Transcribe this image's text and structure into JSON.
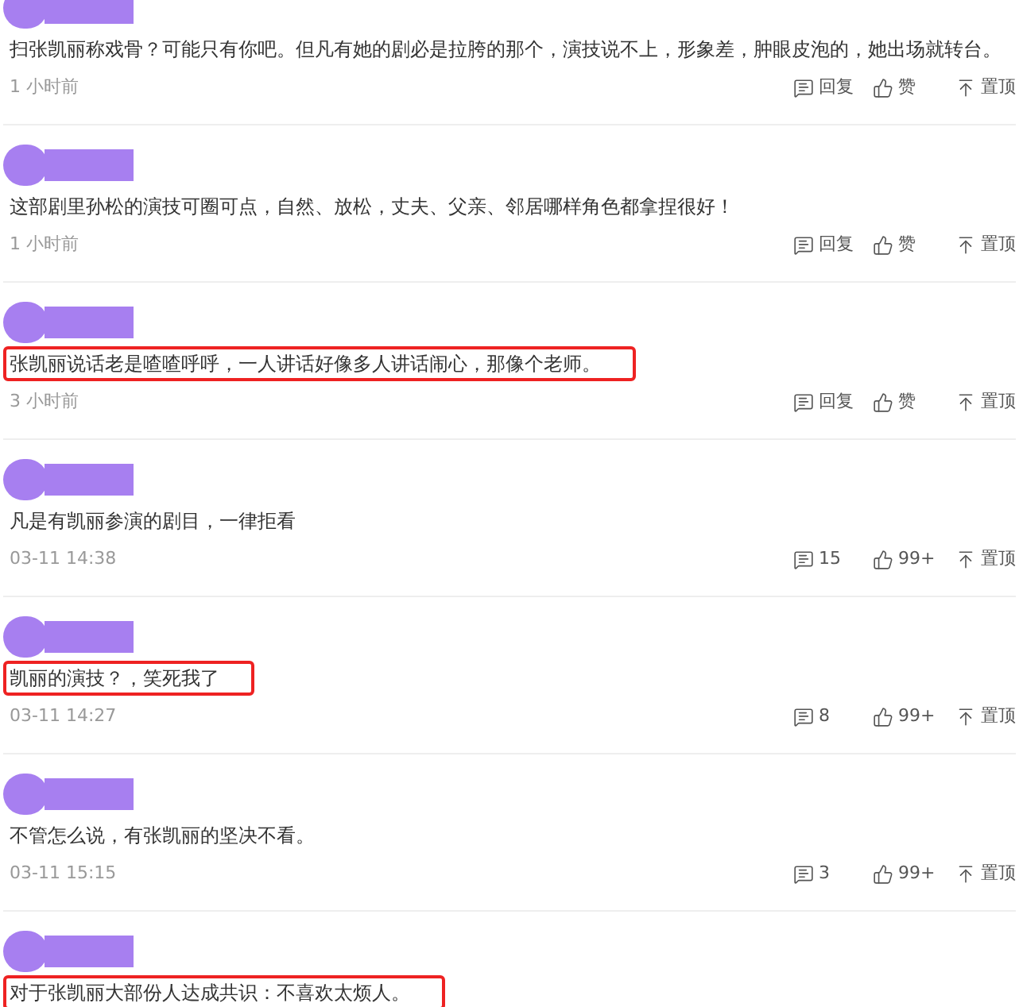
{
  "comments": [
    {
      "text": "扫张凯丽称戏骨？可能只有你吧。但凡有她的剧必是拉胯的那个，演技说不上，形象差，肿眼皮泡的，她出场就转台。",
      "highlighted": false,
      "time": "1 小时前",
      "reply": "回复",
      "like": "赞",
      "pin": "置顶"
    },
    {
      "text": "这部剧里孙松的演技可圈可点，自然、放松，丈夫、父亲、邻居哪样角色都拿捏很好！",
      "highlighted": false,
      "time": "1 小时前",
      "reply": "回复",
      "like": "赞",
      "pin": "置顶"
    },
    {
      "text": "张凯丽说话老是喳喳呼呼，一人讲话好像多人讲话闹心，那像个老师。",
      "highlighted": true,
      "time": "3 小时前",
      "reply": "回复",
      "like": "赞",
      "pin": "置顶"
    },
    {
      "text": "凡是有凯丽参演的剧目，一律拒看",
      "highlighted": false,
      "time": "03-11 14:38",
      "reply": "15",
      "like": "99+",
      "pin": "置顶"
    },
    {
      "text": "凯丽的演技？，笑死我了",
      "highlighted": true,
      "time": "03-11 14:27",
      "reply": "8",
      "like": "99+",
      "pin": "置顶"
    },
    {
      "text": "不管怎么说，有张凯丽的坚决不看。",
      "highlighted": false,
      "time": "03-11 15:15",
      "reply": "3",
      "like": "99+",
      "pin": "置顶"
    },
    {
      "text": "对于张凯丽大部份人达成共识：不喜欢太烦人。",
      "highlighted": true
    }
  ]
}
